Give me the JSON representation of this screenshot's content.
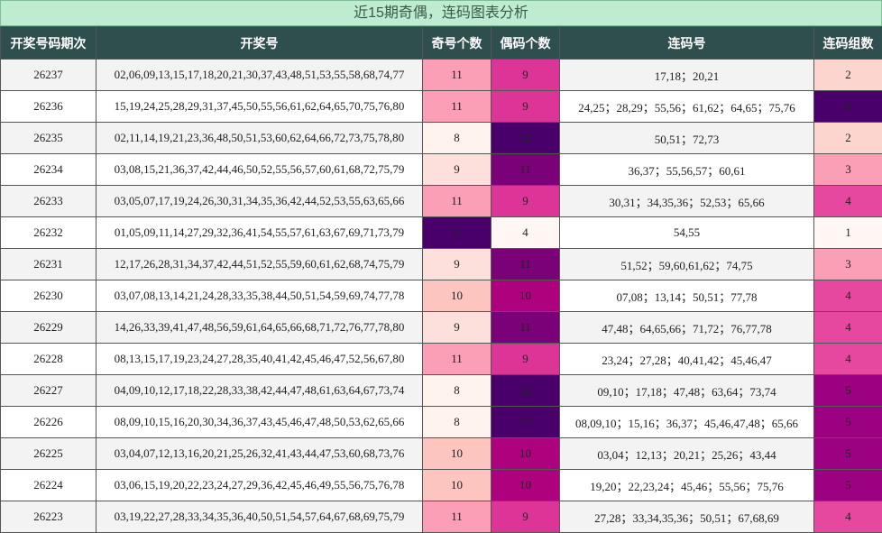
{
  "title": "近15期奇偶，连码图表分析",
  "headers": [
    "开奖号码期次",
    "开奖号",
    "奇号个数",
    "偶码个数",
    "连码号",
    "连码组数"
  ],
  "rows": [
    {
      "period": "26237",
      "numbers": "02,06,09,13,15,17,18,20,21,30,37,43,48,51,53,55,58,68,74,77",
      "odd": "11",
      "even": "9",
      "consec": "17,18；20,21",
      "groups": "2"
    },
    {
      "period": "26236",
      "numbers": "15,19,24,25,28,29,31,37,45,50,55,56,61,62,64,65,70,75,76,80",
      "odd": "11",
      "even": "9",
      "consec": "24,25；28,29；55,56；61,62；64,65；75,76",
      "groups": "6"
    },
    {
      "period": "26235",
      "numbers": "02,11,14,19,21,23,36,48,50,51,53,60,62,64,66,72,73,75,78,80",
      "odd": "8",
      "even": "12",
      "consec": "50,51；72,73",
      "groups": "2"
    },
    {
      "period": "26234",
      "numbers": "03,08,15,21,36,37,42,44,46,50,52,55,56,57,60,61,68,72,75,79",
      "odd": "9",
      "even": "11",
      "consec": "36,37；55,56,57；60,61",
      "groups": "3"
    },
    {
      "period": "26233",
      "numbers": "03,05,07,17,19,24,26,30,31,34,35,36,42,44,52,53,55,63,65,66",
      "odd": "11",
      "even": "9",
      "consec": "30,31；34,35,36；52,53；65,66",
      "groups": "4"
    },
    {
      "period": "26232",
      "numbers": "01,05,09,11,14,27,29,32,36,41,54,55,57,61,63,67,69,71,73,79",
      "odd": "16",
      "even": "4",
      "consec": "54,55",
      "groups": "1"
    },
    {
      "period": "26231",
      "numbers": "12,17,26,28,31,34,37,42,44,51,52,55,59,60,61,62,68,74,75,79",
      "odd": "9",
      "even": "11",
      "consec": "51,52；59,60,61,62；74,75",
      "groups": "3"
    },
    {
      "period": "26230",
      "numbers": "03,07,08,13,14,21,24,28,33,35,38,44,50,51,54,59,69,74,77,78",
      "odd": "10",
      "even": "10",
      "consec": "07,08；13,14；50,51；77,78",
      "groups": "4"
    },
    {
      "period": "26229",
      "numbers": "14,26,33,39,41,47,48,56,59,61,64,65,66,68,71,72,76,77,78,80",
      "odd": "9",
      "even": "11",
      "consec": "47,48；64,65,66；71,72；76,77,78",
      "groups": "4"
    },
    {
      "period": "26228",
      "numbers": "08,13,15,17,19,23,24,27,28,35,40,41,42,45,46,47,52,56,67,80",
      "odd": "11",
      "even": "9",
      "consec": "23,24；27,28；40,41,42；45,46,47",
      "groups": "4"
    },
    {
      "period": "26227",
      "numbers": "04,09,10,12,17,18,22,28,33,38,42,44,47,48,61,63,64,67,73,74",
      "odd": "8",
      "even": "12",
      "consec": "09,10；17,18；47,48；63,64；73,74",
      "groups": "5"
    },
    {
      "period": "26226",
      "numbers": "08,09,10,15,16,20,30,34,36,37,43,45,46,47,48,50,53,62,65,66",
      "odd": "8",
      "even": "12",
      "consec": "08,09,10；15,16；36,37；45,46,47,48；65,66",
      "groups": "5"
    },
    {
      "period": "26225",
      "numbers": "03,04,07,12,13,16,20,21,25,26,32,41,43,44,47,53,60,68,73,76",
      "odd": "10",
      "even": "10",
      "consec": "03,04；12,13；20,21；25,26；43,44",
      "groups": "5"
    },
    {
      "period": "26224",
      "numbers": "03,06,15,19,20,22,23,24,27,29,36,42,45,46,49,55,56,75,76,78",
      "odd": "10",
      "even": "10",
      "consec": "19,20；22,23,24；45,46；55,56；75,76",
      "groups": "5"
    },
    {
      "period": "26223",
      "numbers": "03,19,22,27,28,33,34,35,36,40,50,51,54,57,64,67,68,69,75,79",
      "odd": "11",
      "even": "9",
      "consec": "27,28；33,34,35,36；50,51；67,68,69",
      "groups": "4"
    }
  ],
  "colors": {
    "title_bg": "#bdecd0",
    "header_bg": "#2f4e4e",
    "odd_count": {
      "8": "#fff3ee",
      "9": "#fde0dc",
      "10": "#fcc5c0",
      "11": "#fa9fb5",
      "16": "#49006a"
    },
    "even_count": {
      "4": "#fff7f3",
      "9": "#dd3497",
      "10": "#ae017e",
      "11": "#7a0177",
      "12": "#49006a"
    },
    "group_count": {
      "1": "#fff7f3",
      "2": "#fcd5cf",
      "3": "#fa9fb5",
      "4": "#e6479f",
      "5": "#9c0181",
      "6": "#49006a"
    }
  }
}
